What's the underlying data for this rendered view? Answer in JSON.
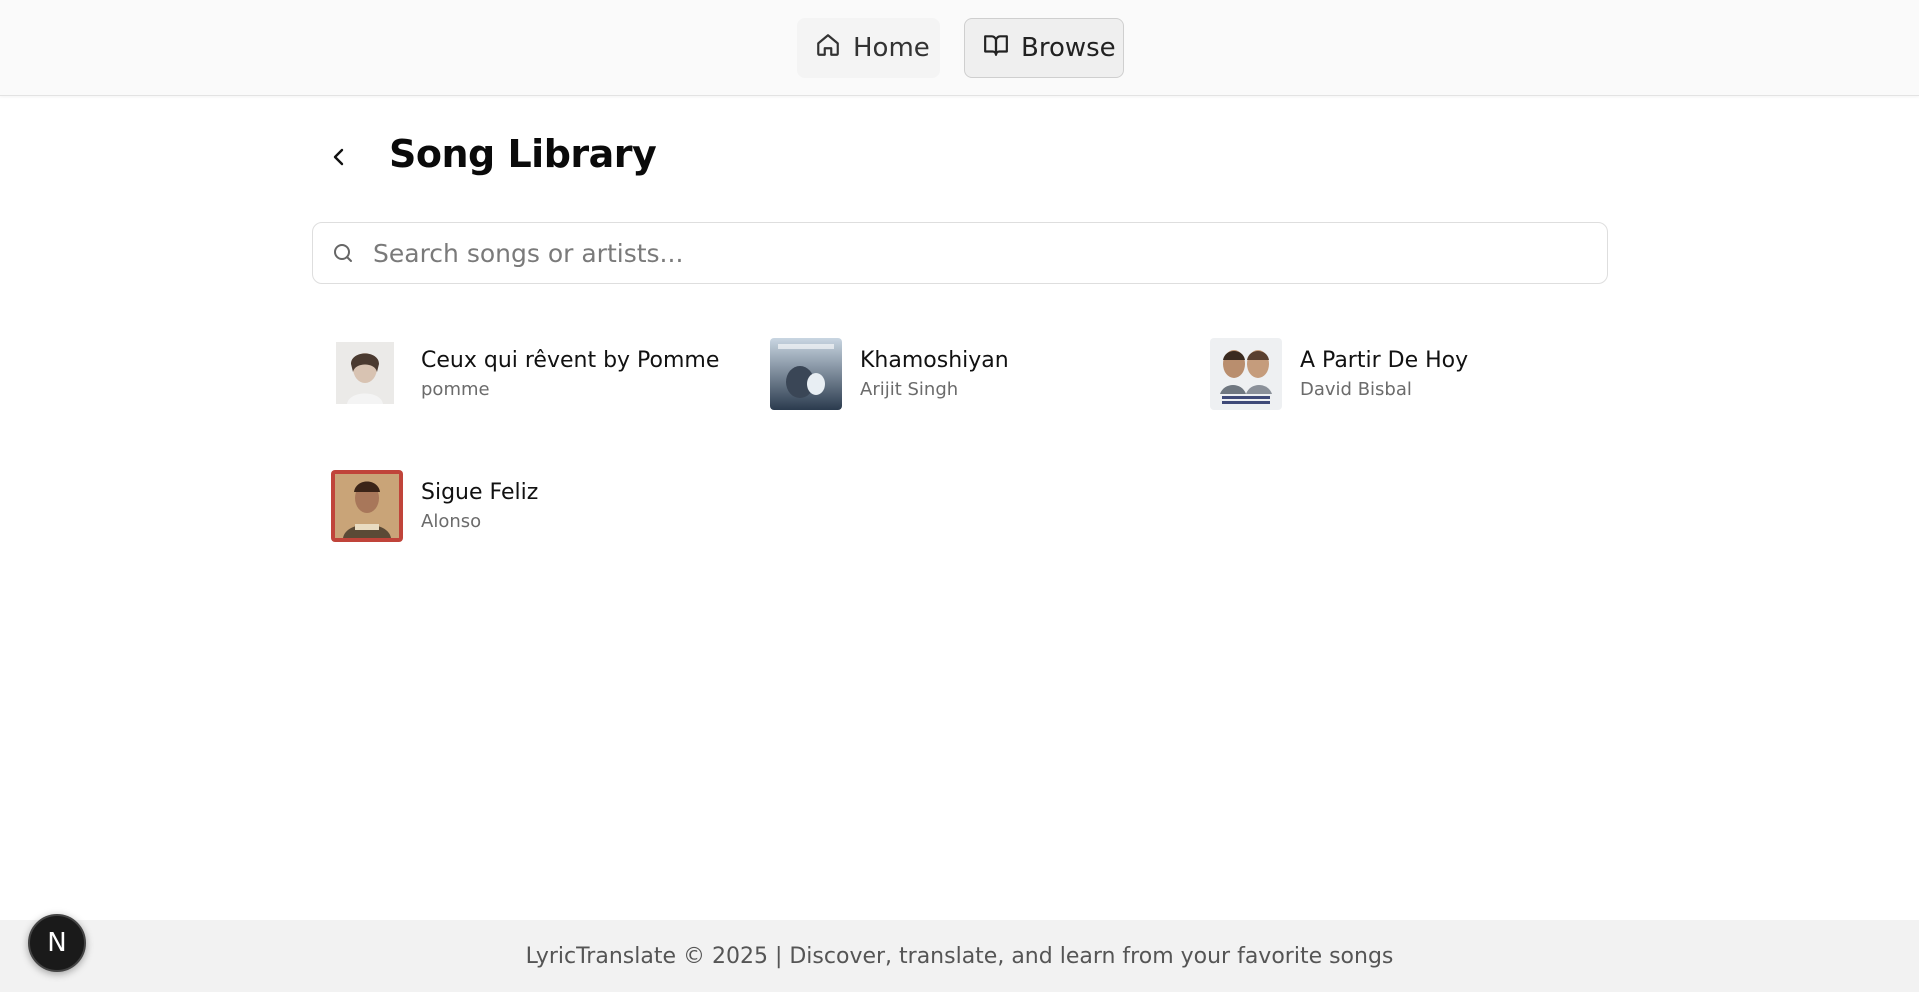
{
  "nav": {
    "home_label": "Home",
    "browse_label": "Browse"
  },
  "page": {
    "title": "Song Library"
  },
  "search": {
    "placeholder": "Search songs or artists...",
    "value": ""
  },
  "songs": [
    {
      "title": "Ceux qui rêvent by Pomme",
      "artist": "pomme"
    },
    {
      "title": "Khamoshiyan",
      "artist": "Arijit Singh"
    },
    {
      "title": "A Partir De Hoy",
      "artist": "David Bisbal"
    },
    {
      "title": "Sigue Feliz",
      "artist": "Alonso"
    }
  ],
  "footer": {
    "text": "LyricTranslate © 2025 | Discover, translate, and learn from your favorite songs"
  },
  "badge": {
    "letter": "N"
  },
  "icons": {
    "home": "home-icon",
    "browse": "book-open-icon",
    "back": "chevron-left-icon",
    "search": "search-icon"
  }
}
